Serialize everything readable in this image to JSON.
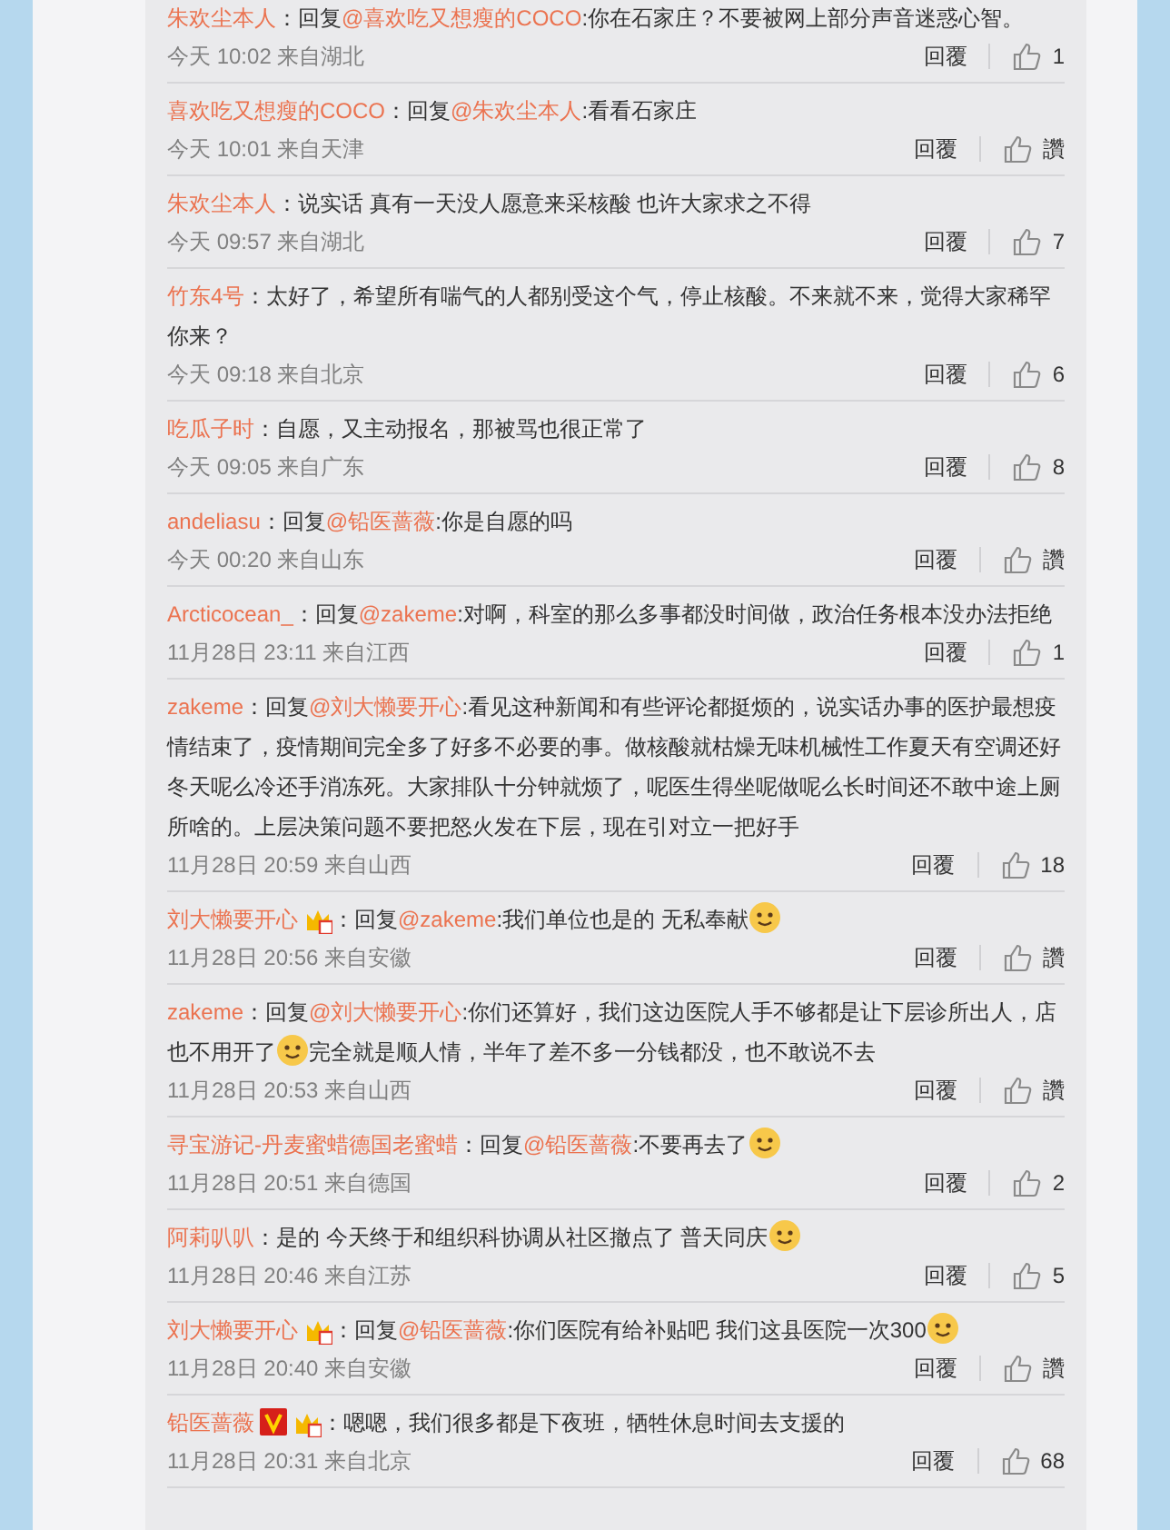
{
  "comments": [
    {
      "user": "朱欢尘本人",
      "colon": "：",
      "reply_prefix": "回复",
      "reply_to": "@喜欢吃又想瘦的COCO",
      "parts": [
        {
          "kind": "text",
          "text": ":你在石家庄？不要被网上部分声音迷惑心智。"
        }
      ],
      "meta": "今天 10:02 来自湖北",
      "reply_label": "回覆",
      "likes": "1"
    },
    {
      "user": "喜欢吃又想瘦的COCO",
      "colon": "：",
      "reply_prefix": "回复",
      "reply_to": "@朱欢尘本人",
      "parts": [
        {
          "kind": "text",
          "text": ":看看石家庄"
        }
      ],
      "meta": "今天 10:01 来自天津",
      "reply_label": "回覆",
      "likes": "讚"
    },
    {
      "user": "朱欢尘本人",
      "colon": "：",
      "parts": [
        {
          "kind": "text",
          "text": "说实话 真有一天没人愿意来采核酸 也许大家求之不得"
        }
      ],
      "meta": "今天 09:57 来自湖北",
      "reply_label": "回覆",
      "likes": "7"
    },
    {
      "user": "竹东4号",
      "colon": "：",
      "parts": [
        {
          "kind": "text",
          "text": "太好了，希望所有喘气的人都别受这个气，停止核酸。不来就不来，觉得大家稀罕你来？"
        }
      ],
      "meta": "今天 09:18 来自北京",
      "reply_label": "回覆",
      "likes": "6"
    },
    {
      "user": "吃瓜子时",
      "colon": "：",
      "parts": [
        {
          "kind": "text",
          "text": "自愿，又主动报名，那被骂也很正常了"
        }
      ],
      "meta": "今天 09:05 来自广东",
      "reply_label": "回覆",
      "likes": "8"
    },
    {
      "user": "andeliasu",
      "colon": "：",
      "reply_prefix": "回复",
      "reply_to": "@铅医蔷薇",
      "parts": [
        {
          "kind": "text",
          "text": ":你是自愿的吗"
        }
      ],
      "meta": "今天 00:20 来自山东",
      "reply_label": "回覆",
      "likes": "讚"
    },
    {
      "user": "Arcticocean_",
      "colon": "：",
      "reply_prefix": "回复",
      "reply_to": "@zakeme",
      "parts": [
        {
          "kind": "text",
          "text": ":对啊，科室的那么多事都没时间做，政治任务根本没办法拒绝"
        }
      ],
      "meta": "11月28日 23:11 来自江西",
      "reply_label": "回覆",
      "likes": "1"
    },
    {
      "user": "zakeme",
      "colon": "：",
      "reply_prefix": "回复",
      "reply_to": "@刘大懒要开心",
      "parts": [
        {
          "kind": "text",
          "text": ":看见这种新闻和有些评论都挺烦的，说实话办事的医护最想疫情结束了，疫情期间完全多了好多不必要的事。做核酸就枯燥无味机械性工作夏天有空调还好冬天呢么冷还手消冻死。大家排队十分钟就烦了，呢医生得坐呢做呢么长时间还不敢中途上厕所啥的。上层决策问题不要把怒火发在下层，现在引对立一把好手"
        }
      ],
      "meta": "11月28日 20:59 来自山西",
      "reply_label": "回覆",
      "likes": "18"
    },
    {
      "user": "刘大懒要开心",
      "badges": [
        {
          "kind": "vip"
        }
      ],
      "colon": "：",
      "reply_prefix": "回复",
      "reply_to": "@zakeme",
      "parts": [
        {
          "kind": "text",
          "text": ":我们单位也是的 无私奉献"
        },
        {
          "kind": "emoji"
        }
      ],
      "meta": "11月28日 20:56 来自安徽",
      "reply_label": "回覆",
      "likes": "讚"
    },
    {
      "user": "zakeme",
      "colon": "：",
      "reply_prefix": "回复",
      "reply_to": "@刘大懒要开心",
      "parts": [
        {
          "kind": "text",
          "text": ":你们还算好，我们这边医院人手不够都是让下层诊所出人，店也不用开了"
        },
        {
          "kind": "emoji"
        },
        {
          "kind": "text",
          "text": "完全就是顺人情，半年了差不多一分钱都没，也不敢说不去"
        }
      ],
      "meta": "11月28日 20:53 来自山西",
      "reply_label": "回覆",
      "likes": "讚"
    },
    {
      "user": "寻宝游记-丹麦蜜蜡德国老蜜蜡",
      "colon": "：",
      "reply_prefix": "回复",
      "reply_to": "@铅医蔷薇",
      "parts": [
        {
          "kind": "text",
          "text": ":不要再去了"
        },
        {
          "kind": "emoji"
        }
      ],
      "meta": "11月28日 20:51 来自德国",
      "reply_label": "回覆",
      "likes": "2"
    },
    {
      "user": "阿莉叭叭",
      "colon": "：",
      "parts": [
        {
          "kind": "text",
          "text": "是的 今天终于和组织科协调从社区撤点了 普天同庆"
        },
        {
          "kind": "emoji"
        }
      ],
      "meta": "11月28日 20:46 来自江苏",
      "reply_label": "回覆",
      "likes": "5"
    },
    {
      "user": "刘大懒要开心",
      "badges": [
        {
          "kind": "vip"
        }
      ],
      "colon": "：",
      "reply_prefix": "回复",
      "reply_to": "@铅医蔷薇",
      "parts": [
        {
          "kind": "text",
          "text": ":你们医院有给补贴吧 我们这县医院一次300"
        },
        {
          "kind": "emoji"
        }
      ],
      "meta": "11月28日 20:40 来自安徽",
      "reply_label": "回覆",
      "likes": "讚"
    },
    {
      "user": "铅医蔷薇",
      "badges": [
        {
          "kind": "verified"
        },
        {
          "kind": "vip"
        }
      ],
      "colon": "：",
      "parts": [
        {
          "kind": "text",
          "text": "嗯嗯，我们很多都是下夜班，牺牲休息时间去支援的"
        }
      ],
      "meta": "11月28日 20:31 来自北京",
      "reply_label": "回覆",
      "likes": "68"
    }
  ]
}
